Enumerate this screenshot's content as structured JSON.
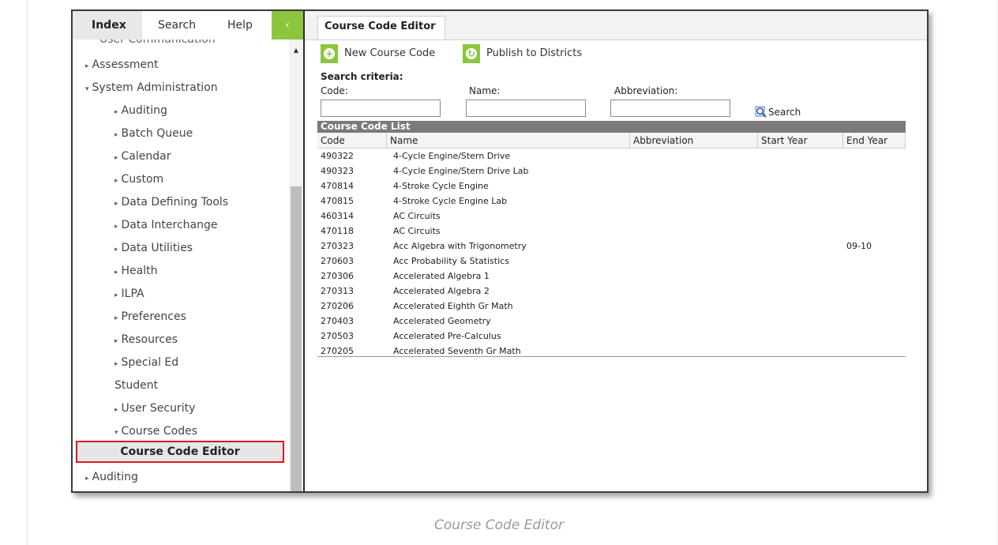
{
  "nav": {
    "tabs": [
      {
        "label": "Index"
      },
      {
        "label": "Search"
      },
      {
        "label": "Help"
      }
    ],
    "collapse_glyph": "‹",
    "items": [
      {
        "label": "User Communication",
        "caret": ""
      },
      {
        "label": "Assessment",
        "caret": "▸"
      },
      {
        "label": "System Administration",
        "caret": "▾"
      },
      {
        "label": "Auditing",
        "caret": "▸"
      },
      {
        "label": "Batch Queue",
        "caret": "▸"
      },
      {
        "label": "Calendar",
        "caret": "▸"
      },
      {
        "label": "Custom",
        "caret": "▸"
      },
      {
        "label": "Data Defining Tools",
        "caret": "▸"
      },
      {
        "label": "Data Interchange",
        "caret": "▸"
      },
      {
        "label": "Data Utilities",
        "caret": "▸"
      },
      {
        "label": "Health",
        "caret": "▸"
      },
      {
        "label": "ILPA",
        "caret": "▸"
      },
      {
        "label": "Preferences",
        "caret": "▸"
      },
      {
        "label": "Resources",
        "caret": "▸"
      },
      {
        "label": "Special Ed",
        "caret": "▸"
      },
      {
        "label": "Student",
        "caret": ""
      },
      {
        "label": "User Security",
        "caret": "▸"
      },
      {
        "label": "Course Codes",
        "caret": "▾"
      },
      {
        "label": "Course Code Editor",
        "caret": ""
      },
      {
        "label": "Auditing",
        "caret": "▸"
      }
    ]
  },
  "main": {
    "tab_label": "Course Code Editor",
    "toolbar": {
      "new_label": "New Course Code",
      "publish_label": "Publish to Districts"
    },
    "search": {
      "title": "Search criteria:",
      "code_label": "Code:",
      "name_label": "Name:",
      "abbr_label": "Abbreviation:",
      "code_value": "",
      "name_value": "",
      "abbr_value": "",
      "button_label": "Search"
    },
    "list": {
      "title": "Course Code List",
      "columns": [
        "Code",
        "Name",
        "Abbreviation",
        "Start Year",
        "End Year"
      ],
      "rows": [
        {
          "code": "490322",
          "name": "4-Cycle Engine/Stern Drive",
          "abbr": "",
          "start": "",
          "end": ""
        },
        {
          "code": "490323",
          "name": "4-Cycle Engine/Stern Drive Lab",
          "abbr": "",
          "start": "",
          "end": ""
        },
        {
          "code": "470814",
          "name": "4-Stroke Cycle Engine",
          "abbr": "",
          "start": "",
          "end": ""
        },
        {
          "code": "470815",
          "name": "4-Stroke Cycle Engine Lab",
          "abbr": "",
          "start": "",
          "end": ""
        },
        {
          "code": "460314",
          "name": "AC Circuits",
          "abbr": "",
          "start": "",
          "end": ""
        },
        {
          "code": "470118",
          "name": "AC Circuits",
          "abbr": "",
          "start": "",
          "end": ""
        },
        {
          "code": "270323",
          "name": "Acc Algebra with Trigonometry",
          "abbr": "",
          "start": "",
          "end": "09-10"
        },
        {
          "code": "270603",
          "name": "Acc Probability & Statistics",
          "abbr": "",
          "start": "",
          "end": ""
        },
        {
          "code": "270306",
          "name": "Accelerated Algebra 1",
          "abbr": "",
          "start": "",
          "end": ""
        },
        {
          "code": "270313",
          "name": "Accelerated Algebra 2",
          "abbr": "",
          "start": "",
          "end": ""
        },
        {
          "code": "270206",
          "name": "Accelerated Eighth Gr Math",
          "abbr": "",
          "start": "",
          "end": ""
        },
        {
          "code": "270403",
          "name": "Accelerated Geometry",
          "abbr": "",
          "start": "",
          "end": ""
        },
        {
          "code": "270503",
          "name": "Accelerated Pre-Calculus",
          "abbr": "",
          "start": "",
          "end": ""
        },
        {
          "code": "270205",
          "name": "Accelerated Seventh Gr Math",
          "abbr": "",
          "start": "",
          "end": ""
        }
      ]
    }
  },
  "caption": "Course Code Editor",
  "colors": {
    "accent_green": "#8cc63f",
    "highlight_red": "#e0161b",
    "list_header": "#7a7a7a"
  }
}
